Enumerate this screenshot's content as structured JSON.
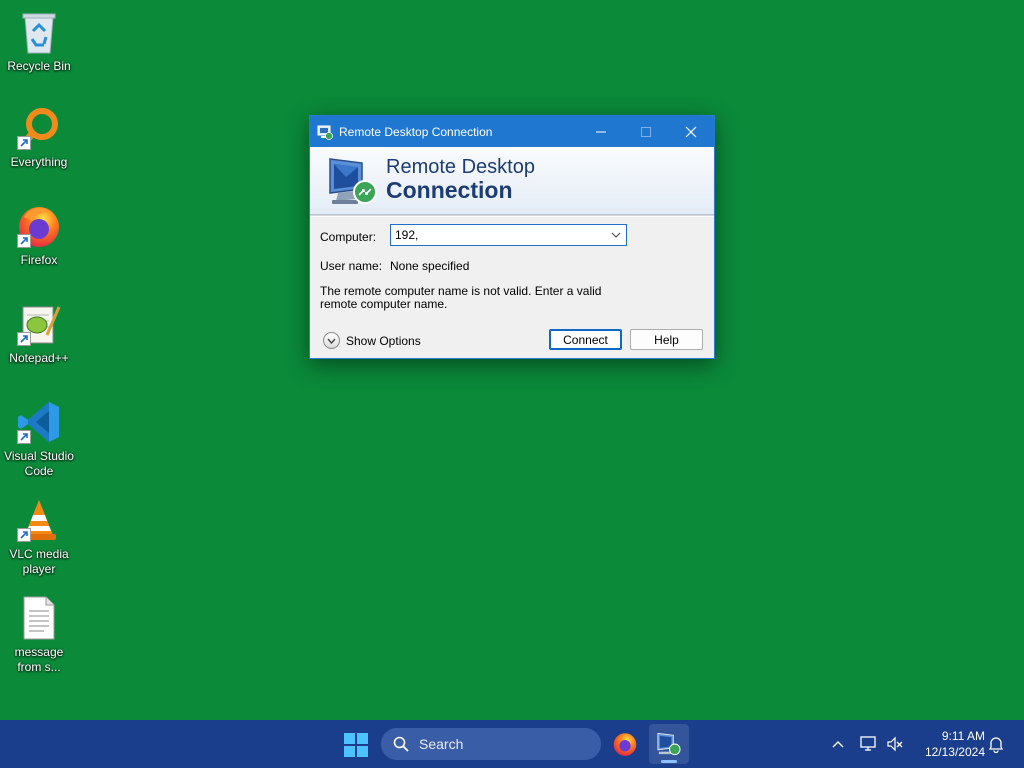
{
  "desktop": {
    "background_color": "#0b8a3a",
    "icons": [
      {
        "label": "Recycle Bin",
        "icon": "recycle-bin-icon"
      },
      {
        "label": "Everything",
        "icon": "everything-search-icon"
      },
      {
        "label": "Firefox",
        "icon": "firefox-icon"
      },
      {
        "label": "Notepad++",
        "icon": "notepad-plus-plus-icon"
      },
      {
        "label": "Visual Studio Code",
        "icon": "vscode-icon"
      },
      {
        "label": "VLC media player",
        "icon": "vlc-icon"
      },
      {
        "label": "message from s...",
        "icon": "text-file-icon"
      }
    ]
  },
  "dialog": {
    "title": "Remote Desktop Connection",
    "banner_line1": "Remote Desktop",
    "banner_line2": "Connection",
    "computer_label": "Computer:",
    "computer_value": "192,",
    "username_label": "User name:",
    "username_value": "None specified",
    "error_message": "The remote computer name is not valid. Enter a valid remote computer name.",
    "show_options_label": "Show Options",
    "connect_label": "Connect",
    "help_label": "Help",
    "accent_color": "#1f77d0"
  },
  "taskbar": {
    "search_placeholder": "Search",
    "time": "9:11 AM",
    "date": "12/13/2024",
    "background_color": "#1a3e8c"
  }
}
